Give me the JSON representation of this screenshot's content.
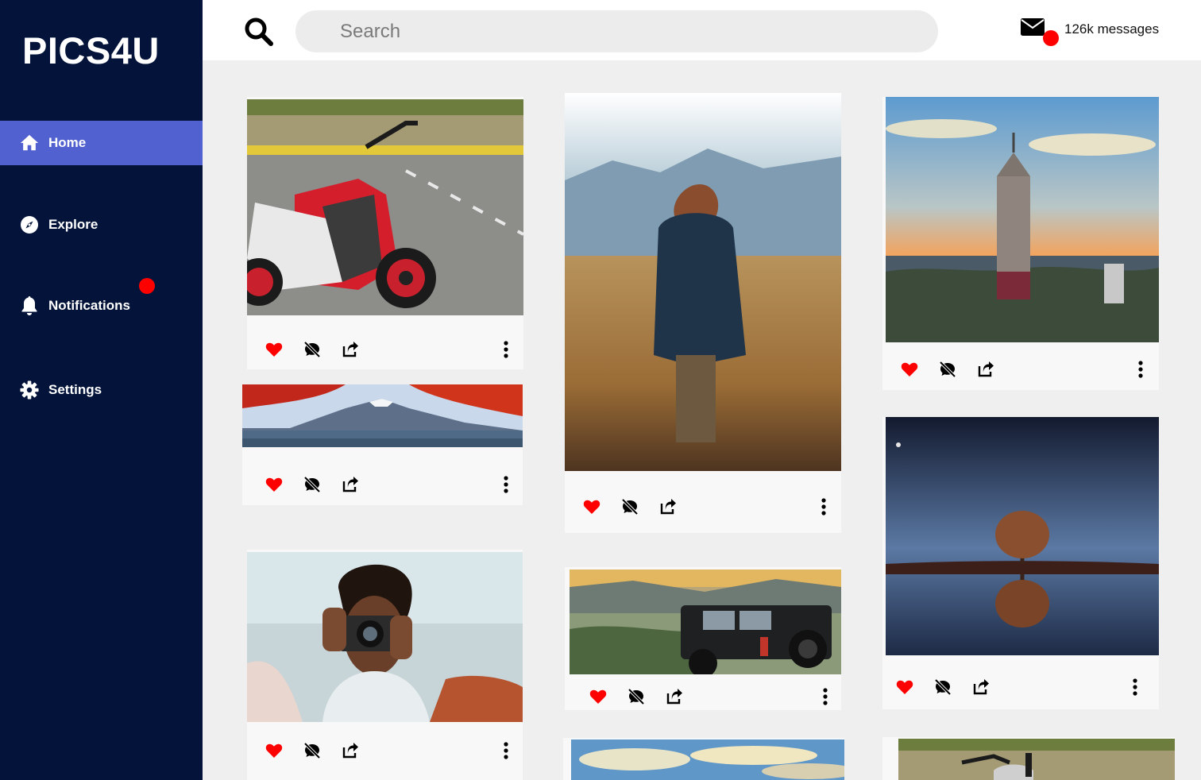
{
  "app": {
    "logo": "PICS4U"
  },
  "sidebar": {
    "items": [
      {
        "label": "Home",
        "icon": "home-icon",
        "active": true
      },
      {
        "label": "Explore",
        "icon": "compass-icon",
        "active": false
      },
      {
        "label": "Notifications",
        "icon": "bell-icon",
        "active": false,
        "has_badge": true
      },
      {
        "label": "Settings",
        "icon": "gear-icon",
        "active": false
      }
    ]
  },
  "header": {
    "search_placeholder": "Search",
    "messages_label": "126k messages"
  },
  "colors": {
    "sidebar_bg": "#03133a",
    "active_item": "#5161d0",
    "badge": "#ff0000",
    "like": "#ff0000"
  },
  "feed": {
    "posts": [
      {
        "image": "red-white-scooter-on-road",
        "liked": true
      },
      {
        "image": "mountain-lake-with-red-maple",
        "liked": true
      },
      {
        "image": "woman-holding-camera",
        "liked": true
      },
      {
        "image": "man-in-golden-field",
        "liked": true
      },
      {
        "image": "black-jeep-in-hills",
        "liked": true
      },
      {
        "image": "sky-partial",
        "liked": false
      },
      {
        "image": "tower-at-sunset",
        "liked": true
      },
      {
        "image": "tree-reflection-at-night",
        "liked": true
      },
      {
        "image": "scooter-partial",
        "liked": false
      }
    ]
  }
}
